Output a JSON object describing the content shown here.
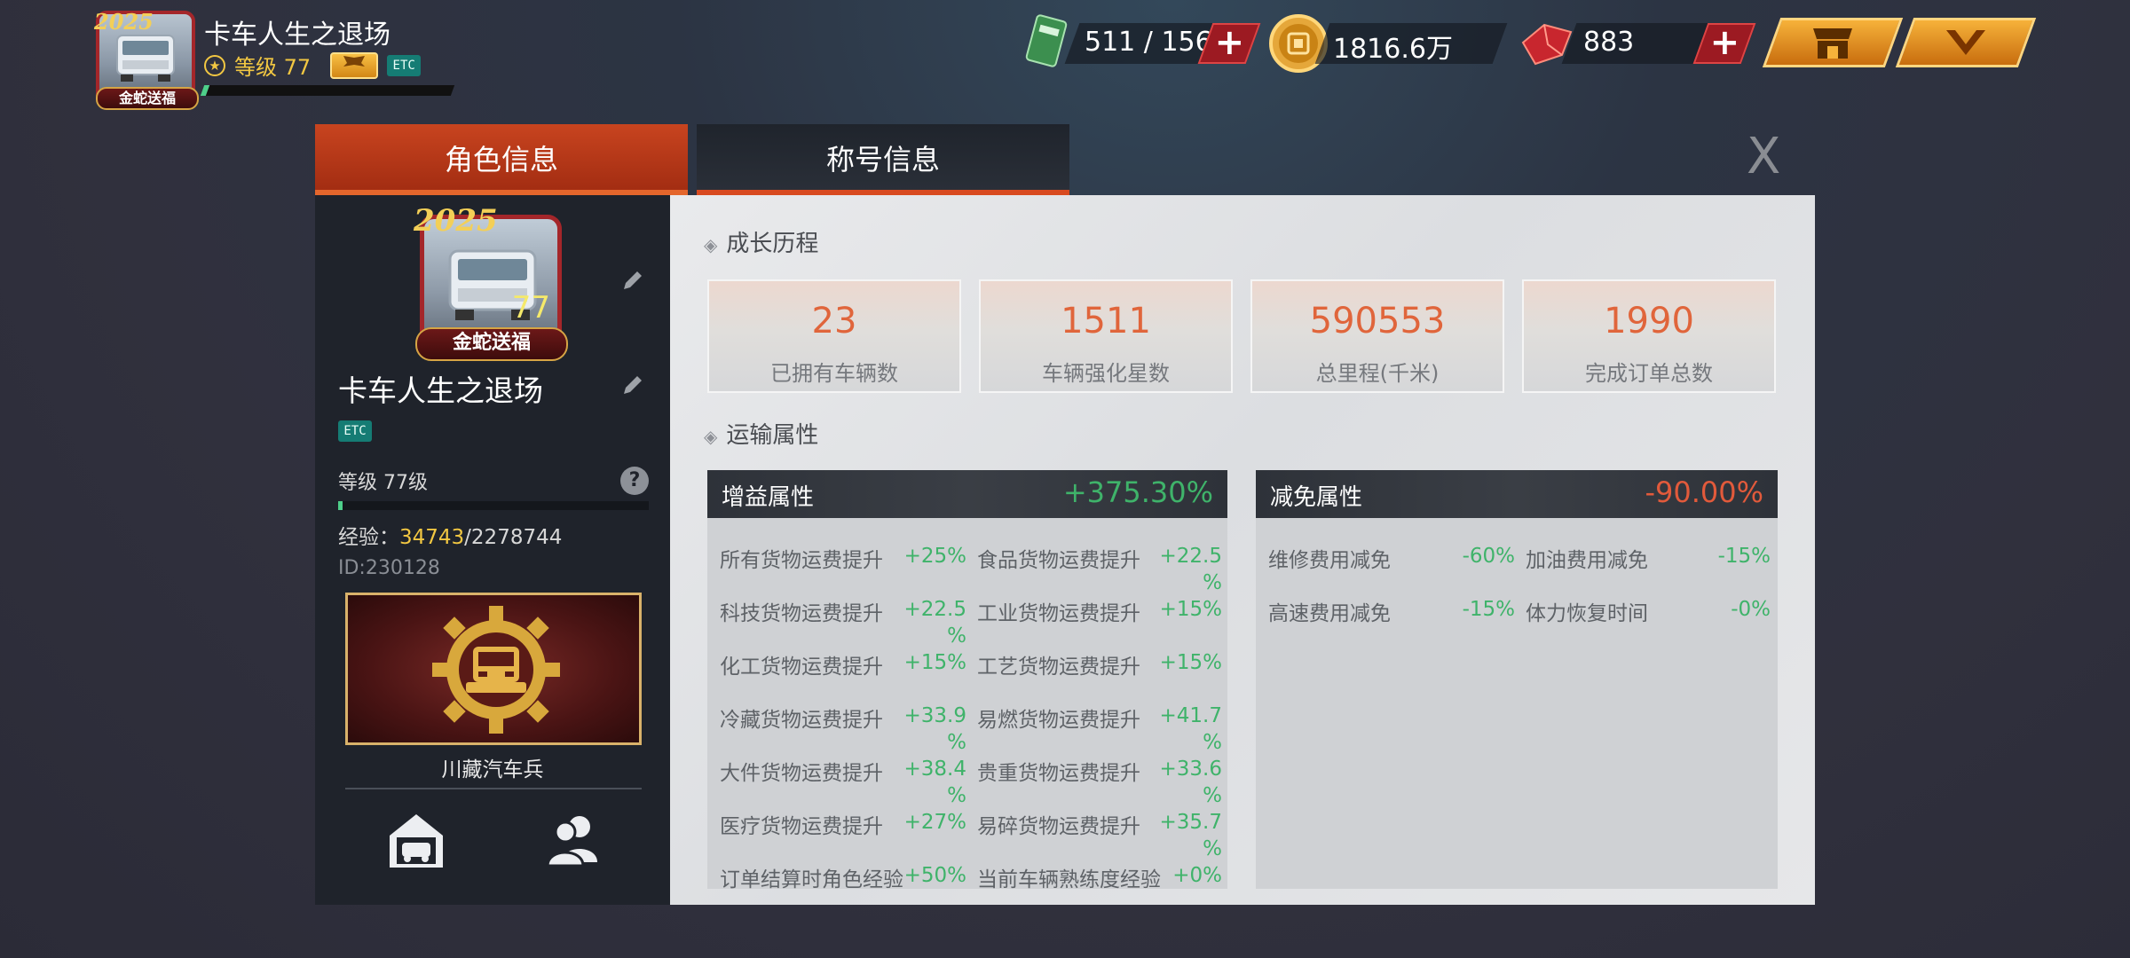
{
  "player": {
    "name": "卡车人生之退场",
    "level_label": "等级 77",
    "etc": "ETC",
    "avatar_year": "2025",
    "avatar_ribbon": "金蛇送福"
  },
  "resources": {
    "fuel": "511 / 156",
    "coins": "1816.6万",
    "gems": "883"
  },
  "tabs": {
    "role_info": "角色信息",
    "title_info": "称号信息"
  },
  "close_label": "X",
  "left": {
    "name": "卡车人生之退场",
    "etc": "ETC",
    "avatar_level": "77",
    "avatar_ribbon": "金蛇送福",
    "level": "等级 77级",
    "help": "?",
    "exp_label": "经验：",
    "exp_current": "34743",
    "exp_total": "/2278744",
    "id": "ID:230128",
    "title_name": "川藏汽车兵"
  },
  "growth": {
    "title": "成长历程",
    "stats": [
      {
        "value": "23",
        "label": "已拥有车辆数"
      },
      {
        "value": "1511",
        "label": "车辆强化星数"
      },
      {
        "value": "590553",
        "label": "总里程(千米)"
      },
      {
        "value": "1990",
        "label": "完成订单总数"
      }
    ]
  },
  "transport": {
    "title": "运输属性",
    "bonus": {
      "title": "增益属性",
      "total": "+375.30%",
      "rows": [
        [
          "所有货物运费提升",
          "+25%",
          "食品货物运费提升",
          "+22.5\n%"
        ],
        [
          "科技货物运费提升",
          "+22.5\n%",
          "工业货物运费提升",
          "+15%"
        ],
        [
          "化工货物运费提升",
          "+15%",
          "工艺货物运费提升",
          "+15%"
        ],
        [
          "冷藏货物运费提升",
          "+33.9\n%",
          "易燃货物运费提升",
          "+41.7\n%"
        ],
        [
          "大件货物运费提升",
          "+38.4\n%",
          "贵重货物运费提升",
          "+33.6\n%"
        ],
        [
          "医疗货物运费提升",
          "+27%",
          "易碎货物运费提升",
          "+35.7\n%"
        ],
        [
          "订单结算时角色经验",
          "+50%",
          "当前车辆熟练度经验",
          "+0%"
        ]
      ]
    },
    "reduction": {
      "title": "减免属性",
      "total": "-90.00%",
      "rows": [
        [
          "维修费用减免",
          "-60%",
          "加油费用减免",
          "-15%"
        ],
        [
          "高速费用减免",
          "-15%",
          "体力恢复时间",
          "-0%"
        ]
      ]
    }
  },
  "colors": {
    "accent_orange": "#c8441f",
    "value_orange": "#e0653b",
    "bonus_green": "#3fb36a",
    "reduction_red": "#e25a3b",
    "gold": "#f2c742"
  }
}
